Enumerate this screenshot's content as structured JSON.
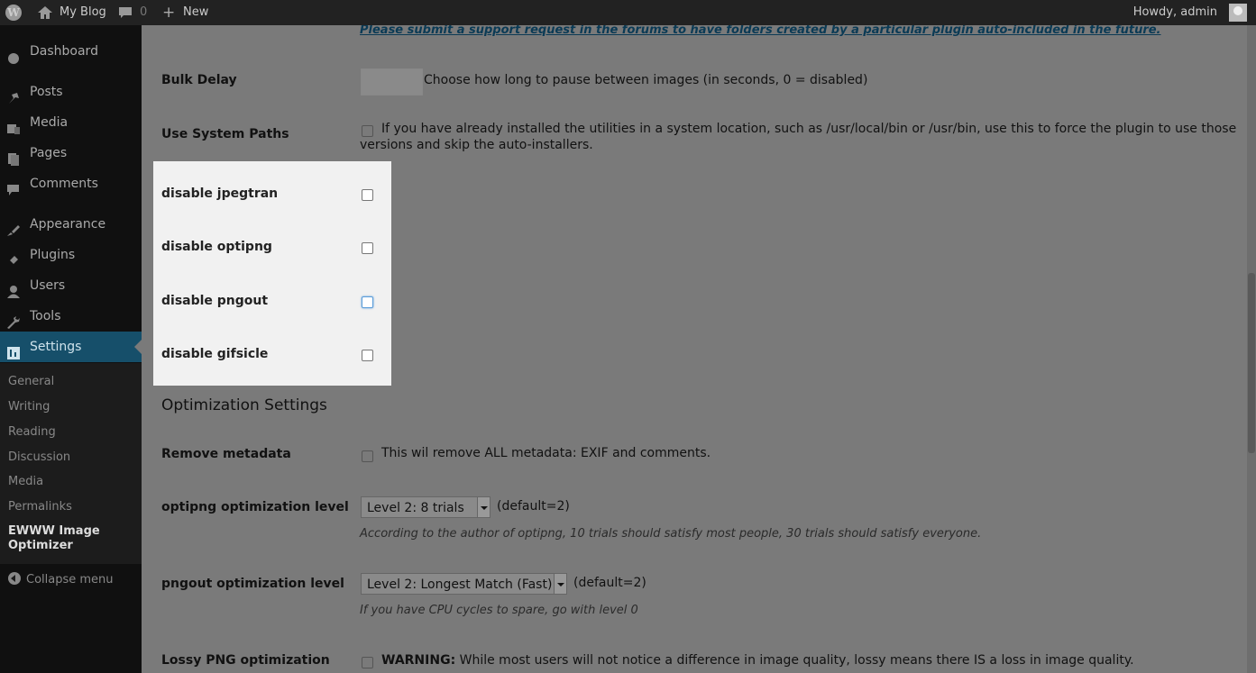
{
  "adminbar": {
    "site_name": "My Blog",
    "comments_count": "0",
    "new_label": "New",
    "howdy": "Howdy, admin"
  },
  "sidebar": {
    "items": [
      {
        "label": "Dashboard",
        "icon": "dashboard-icon"
      },
      {
        "label": "Posts",
        "icon": "pin-icon"
      },
      {
        "label": "Media",
        "icon": "media-icon"
      },
      {
        "label": "Pages",
        "icon": "pages-icon"
      },
      {
        "label": "Comments",
        "icon": "comment-icon"
      },
      {
        "label": "Appearance",
        "icon": "brush-icon"
      },
      {
        "label": "Plugins",
        "icon": "plug-icon"
      },
      {
        "label": "Users",
        "icon": "user-icon"
      },
      {
        "label": "Tools",
        "icon": "wrench-icon"
      },
      {
        "label": "Settings",
        "icon": "settings-icon"
      }
    ],
    "submenu": [
      "General",
      "Writing",
      "Reading",
      "Discussion",
      "Media",
      "Permalinks",
      "EWWW Image Optimizer"
    ],
    "collapse": "Collapse menu"
  },
  "main": {
    "top_link": "Please submit a support request in the forums to have folders created by a particular plugin auto-included in the future.",
    "bulk_delay": {
      "label": "Bulk Delay",
      "value": "",
      "desc": "Choose how long to pause between images (in seconds, 0 = disabled)"
    },
    "system_paths": {
      "label": "Use System Paths",
      "desc_line1": "If you have already installed the utilities in a system location, such as /usr/local/bin or /usr/bin, use this to force the plugin to use those",
      "desc_line2": "versions and skip the auto-installers."
    },
    "disable_options": [
      {
        "label": "disable jpegtran"
      },
      {
        "label": "disable optipng"
      },
      {
        "label": "disable pngout"
      },
      {
        "label": "disable gifsicle"
      }
    ],
    "section_title": "Optimization Settings",
    "remove_metadata": {
      "label": "Remove metadata",
      "desc": "This wil remove ALL metadata: EXIF and comments."
    },
    "optipng_level": {
      "label": "optipng optimization level",
      "selected": "Level 2: 8 trials",
      "default": "(default=2)",
      "hint": "According to the author of optipng, 10 trials should satisfy most people, 30 trials should satisfy everyone."
    },
    "pngout_level": {
      "label": "pngout optimization level",
      "selected": "Level 2: Longest Match (Fast)",
      "default": "(default=2)",
      "hint": "If you have CPU cycles to spare, go with level 0"
    },
    "lossy_png": {
      "label": "Lossy PNG optimization",
      "warning": "WARNING:",
      "desc": "While most users will not notice a difference in image quality, lossy means there IS a loss in image quality."
    }
  }
}
